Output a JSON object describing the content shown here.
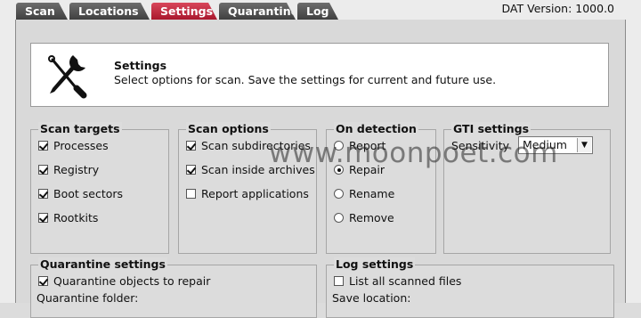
{
  "tabs": [
    {
      "label": "Scan",
      "active": false
    },
    {
      "label": "Locations",
      "active": false
    },
    {
      "label": "Settings",
      "active": true
    },
    {
      "label": "Quarantine",
      "active": false
    },
    {
      "label": "Log",
      "active": false
    }
  ],
  "dat_version": "DAT Version: 1000.0",
  "header": {
    "icon": "tools-icon",
    "title": "Settings",
    "description": "Select options for scan. Save the settings for current and future use."
  },
  "scan_targets": {
    "title": "Scan targets",
    "items": [
      {
        "label": "Processes",
        "checked": true
      },
      {
        "label": "Registry",
        "checked": true
      },
      {
        "label": "Boot sectors",
        "checked": true
      },
      {
        "label": "Rootkits",
        "checked": true
      }
    ]
  },
  "scan_options": {
    "title": "Scan options",
    "items": [
      {
        "label": "Scan subdirectories",
        "checked": true
      },
      {
        "label": "Scan inside archives",
        "checked": true
      },
      {
        "label": "Report applications",
        "checked": false
      }
    ]
  },
  "on_detection": {
    "title": "On detection",
    "items": [
      {
        "label": "Report",
        "checked": false
      },
      {
        "label": "Repair",
        "checked": true
      },
      {
        "label": "Rename",
        "checked": false
      },
      {
        "label": "Remove",
        "checked": false
      }
    ]
  },
  "gti_settings": {
    "title": "GTI settings",
    "sensitivity_label": "Sensitivity",
    "sensitivity_value": "Medium"
  },
  "quarantine_settings": {
    "title": "Quarantine settings",
    "checkbox_label": "Quarantine objects to repair",
    "checkbox_checked": true,
    "folder_label": "Quarantine folder:"
  },
  "log_settings": {
    "title": "Log settings",
    "checkbox_label": "List all scanned files",
    "checkbox_checked": false,
    "location_label": "Save location:"
  },
  "watermark": "www.moonpoet.com"
}
